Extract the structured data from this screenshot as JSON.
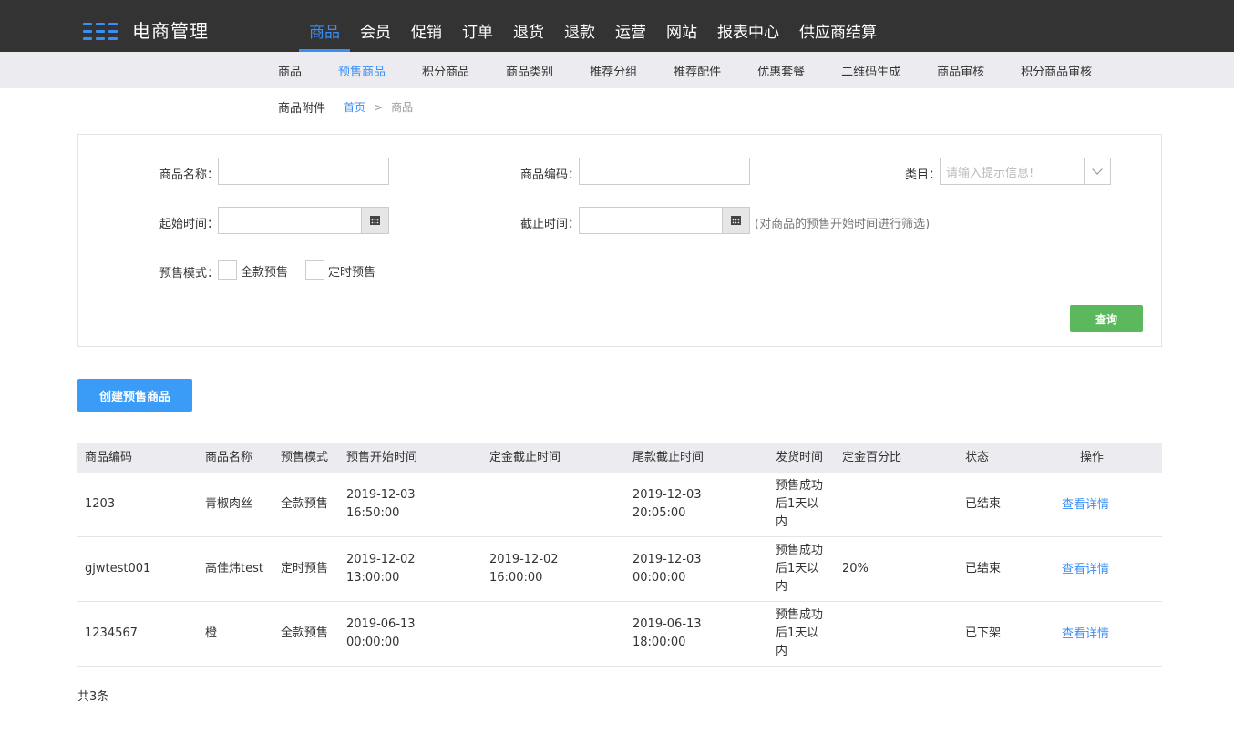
{
  "app": {
    "title": "电商管理",
    "brand_color": "#3a8ef6"
  },
  "main_nav": [
    {
      "label": "商品",
      "active": true
    },
    {
      "label": "会员"
    },
    {
      "label": "促销"
    },
    {
      "label": "订单"
    },
    {
      "label": "退货"
    },
    {
      "label": "退款"
    },
    {
      "label": "运营"
    },
    {
      "label": "网站"
    },
    {
      "label": "报表中心"
    },
    {
      "label": "供应商结算"
    }
  ],
  "sub_nav": [
    {
      "label": "商品"
    },
    {
      "label": "预售商品",
      "active": true
    },
    {
      "label": "积分商品"
    },
    {
      "label": "商品类别"
    },
    {
      "label": "推荐分组"
    },
    {
      "label": "推荐配件"
    },
    {
      "label": "优惠套餐"
    },
    {
      "label": "二维码生成"
    },
    {
      "label": "商品审核"
    },
    {
      "label": "积分商品审核"
    }
  ],
  "sub_nav_extra": "商品附件",
  "breadcrumb": {
    "home": "首页",
    "separator": ">",
    "current": "商品"
  },
  "filters": {
    "name_label": "商品名称：",
    "name_value": "",
    "code_label": "商品编码：",
    "code_value": "",
    "category_label": "类目：",
    "category_placeholder": "请输入提示信息!",
    "start_label": "起始时间：",
    "start_value": "",
    "end_label": "截止时间：",
    "end_value": "",
    "date_hint": "(对商品的预售开始时间进行筛选)",
    "mode_label": "预售模式：",
    "mode_options": [
      {
        "label": "全款预售",
        "checked": false
      },
      {
        "label": "定时预售",
        "checked": false
      }
    ],
    "query_button": "查询"
  },
  "create_button": "创建预售商品",
  "table": {
    "headers": [
      "商品编码",
      "商品名称",
      "预售模式",
      "预售开始时间",
      "定金截止时间",
      "尾款截止时间",
      "发货时间",
      "定金百分比",
      "状态",
      "操作"
    ],
    "rows": [
      {
        "code": "1203",
        "name": "青椒肉丝",
        "mode": "全款预售",
        "start_date": "2019-12-03",
        "start_time": "16:50:00",
        "deposit_date": "",
        "deposit_time": "",
        "final_date": "2019-12-03",
        "final_time": "20:05:00",
        "ship_l1": "预售成功",
        "ship_l2": "后1天以",
        "ship_l3": "内",
        "deposit_pct": "",
        "status": "已结束",
        "action": "查看详情"
      },
      {
        "code": "gjwtest001",
        "name": "高佳炜test",
        "mode": "定时预售",
        "start_date": "2019-12-02",
        "start_time": "13:00:00",
        "deposit_date": "2019-12-02",
        "deposit_time": "16:00:00",
        "final_date": "2019-12-03",
        "final_time": "00:00:00",
        "ship_l1": "预售成功",
        "ship_l2": "后1天以",
        "ship_l3": "内",
        "deposit_pct": "20%",
        "status": "已结束",
        "action": "查看详情"
      },
      {
        "code": "1234567",
        "name": "橙",
        "mode": "全款预售",
        "start_date": "2019-06-13",
        "start_time": "00:00:00",
        "deposit_date": "",
        "deposit_time": "",
        "final_date": "2019-06-13",
        "final_time": "18:00:00",
        "ship_l1": "预售成功",
        "ship_l2": "后1天以",
        "ship_l3": "内",
        "deposit_pct": "",
        "status": "已下架",
        "action": "查看详情"
      }
    ]
  },
  "total_count": "共3条"
}
